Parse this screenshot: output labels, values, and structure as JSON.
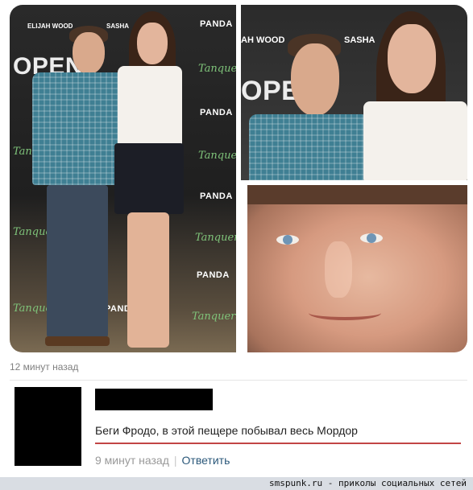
{
  "collage": {
    "backdrop": {
      "name_left": "ELIJAH WOOD",
      "name_right": "SASHA",
      "name_left_crop": "AH WOOD",
      "logo": "PANDA",
      "logo_crop": "PANDA",
      "brand": "Tanqueray",
      "event_word": "OPEN"
    }
  },
  "post": {
    "time": "12 минут назад"
  },
  "comment": {
    "text": "Беги Фродо, в этой пещере побывал весь Мордор",
    "time": "9 минут назад",
    "separator": "|",
    "reply_label": "Ответить"
  },
  "footer": {
    "watermark": "smspunk.ru - приколы социальных сетей"
  },
  "colors": {
    "accent_underline": "#c24545",
    "link": "#2b587a",
    "muted_text": "#999999",
    "brand_green": "#7fc47a"
  }
}
